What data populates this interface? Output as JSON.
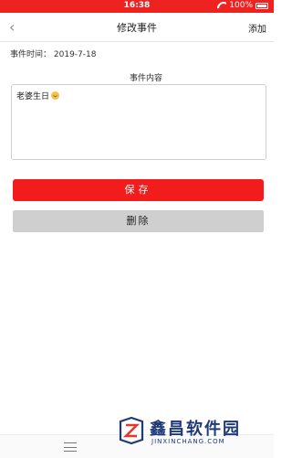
{
  "status_bar": {
    "time": "16:38",
    "battery": "100%"
  },
  "nav": {
    "back_icon": "chevron-left-icon",
    "title": "修改事件",
    "add_label": "添加"
  },
  "event": {
    "time_label": "事件时间：",
    "time_value": "2019-7-18",
    "content_label": "事件内容",
    "content_text": "老婆生日"
  },
  "buttons": {
    "save": "保存",
    "delete": "删除"
  },
  "watermark": {
    "main": "鑫昌软件园",
    "sub": "JINXINCHANG.COM"
  },
  "colors": {
    "accent": "#f21c1c",
    "status_bar": "#ef2222",
    "delete_bg": "#cfcfcf",
    "watermark": "#1f3a78"
  }
}
